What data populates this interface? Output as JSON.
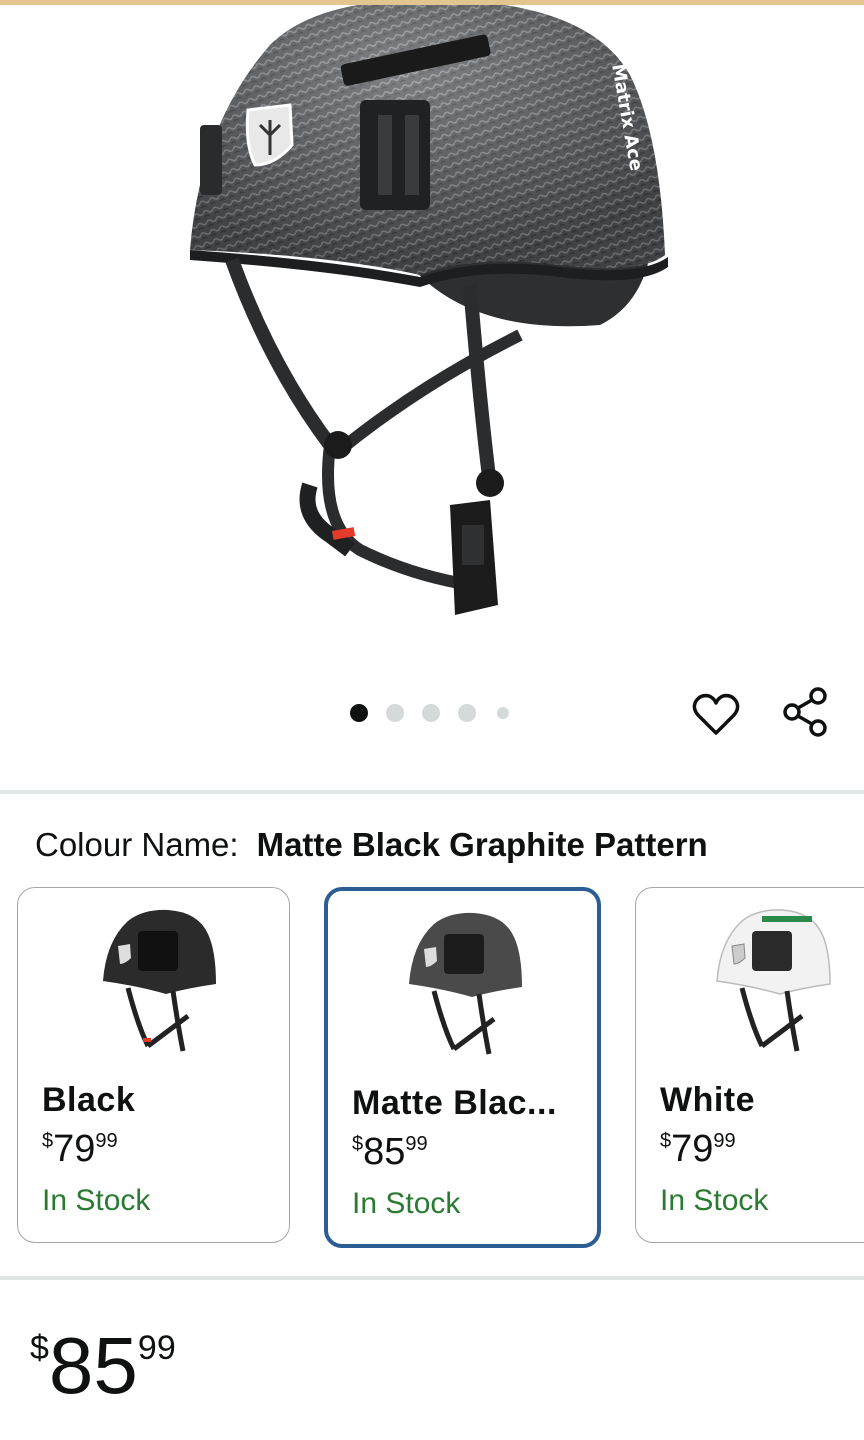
{
  "product": {
    "image_name": "helmet-matte-black-graphite",
    "carousel": {
      "total_images": 5,
      "active_index": 0
    }
  },
  "actions": {
    "favorite_icon": "heart-icon",
    "share_icon": "share-icon"
  },
  "colour": {
    "label": "Colour Name:",
    "selected": "Matte Black Graphite Pattern"
  },
  "swatches": [
    {
      "name": "Black",
      "currency": "$",
      "whole": "79",
      "fraction": "99",
      "stock": "In Stock",
      "selected": false,
      "helmet_color": "#2b2b2b"
    },
    {
      "name": "Matte Blac...",
      "currency": "$",
      "whole": "85",
      "fraction": "99",
      "stock": "In Stock",
      "selected": true,
      "helmet_color": "#4a4a4a"
    },
    {
      "name": "White",
      "currency": "$",
      "whole": "79",
      "fraction": "99",
      "stock": "In Stock",
      "selected": false,
      "helmet_color": "#f2f2f2"
    }
  ],
  "price": {
    "currency": "$",
    "whole": "85",
    "fraction": "99"
  },
  "colors": {
    "accent_selected_border": "#2d5d95",
    "in_stock": "#2a7b32",
    "top_strip": "#e3c58f"
  }
}
